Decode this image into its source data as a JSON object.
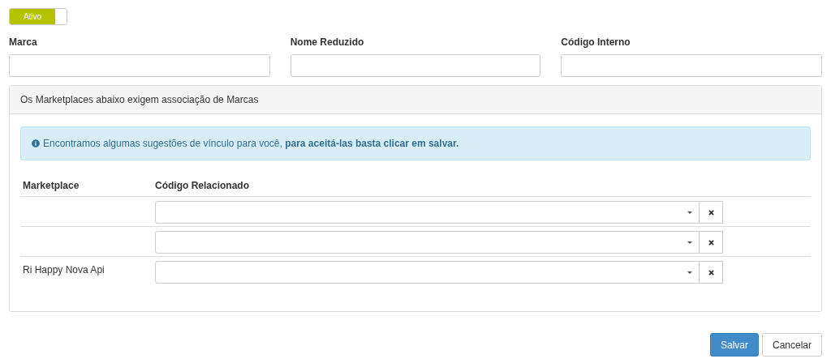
{
  "status_toggle": {
    "label": "Ativo",
    "on": true
  },
  "fields": [
    {
      "label": "Marca"
    },
    {
      "label": "Nome Reduzido"
    },
    {
      "label": "Código Interno"
    }
  ],
  "panel": {
    "title": "Os Marketplaces abaixo exigem associação de Marcas",
    "alert": "Encontramos algumas sugestões de vínculo para você, **para aceitá-las basta clicar em salvar.**",
    "columns": [
      "Marketplace",
      "Código Relacionado"
    ],
    "rows": [
      {},
      {},
      {
        "marketplace": "Ri Happy Nova Api"
      }
    ]
  },
  "buttons": [
    {
      "label": "Salvar",
      "kind": "primary"
    },
    {
      "label": "Cancelar",
      "kind": "default"
    }
  ]
}
